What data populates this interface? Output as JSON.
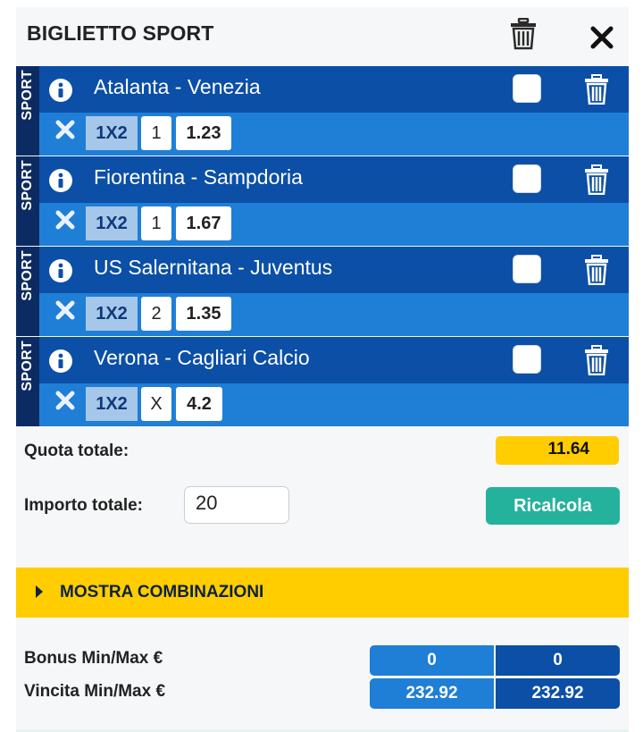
{
  "header": {
    "title": "BIGLIETTO SPORT"
  },
  "bets": [
    {
      "sport_label": "SPORT",
      "match": "Atalanta - Venezia",
      "market": "1X2",
      "selection": "1",
      "odd": "1.23"
    },
    {
      "sport_label": "SPORT",
      "match": "Fiorentina - Sampdoria",
      "market": "1X2",
      "selection": "1",
      "odd": "1.67"
    },
    {
      "sport_label": "SPORT",
      "match": "US Salernitana - Juventus",
      "market": "1X2",
      "selection": "2",
      "odd": "1.35"
    },
    {
      "sport_label": "SPORT",
      "match": "Verona - Cagliari Calcio",
      "market": "1X2",
      "selection": "X",
      "odd": "4.2"
    }
  ],
  "totals": {
    "quota_label": "Quota totale:",
    "quota_value": "11.64",
    "amount_label": "Importo totale:",
    "amount_value": "20",
    "recalc_label": "Ricalcola"
  },
  "combinations": {
    "label": "MOSTRA COMBINAZIONI"
  },
  "summary": {
    "bonus_label": "Bonus Min/Max €",
    "bonus_min": "0",
    "bonus_max": "0",
    "win_label": "Vincita Min/Max €",
    "win_min": "232.92",
    "win_max": "232.92"
  },
  "colors": {
    "dark_navy": "#0d2b63",
    "row_blue": "#0b4fa6",
    "row_light_blue": "#1f7ed6",
    "market_chip": "#a6c7ea",
    "accent_yellow": "#ffcd00",
    "recalc_green": "#25b29c"
  },
  "icons": [
    "trash-icon",
    "close-icon",
    "info-icon",
    "remove-x-icon",
    "caret-right-icon"
  ]
}
